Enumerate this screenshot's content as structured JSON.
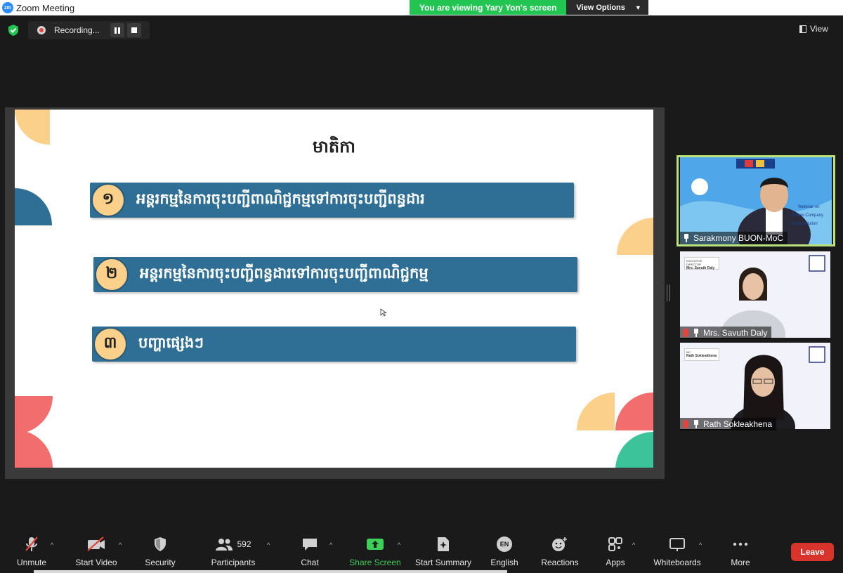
{
  "window": {
    "title": "Zoom Meeting",
    "logo_text": "zm"
  },
  "banner": {
    "viewing": "You are viewing Yary Yon's screen",
    "view_options": "View Options"
  },
  "recording": {
    "label": "Recording..."
  },
  "view_button": {
    "label": "View"
  },
  "slide": {
    "title": "មាតិកា",
    "items": [
      {
        "num": "១",
        "text": "អន្តរកម្មនៃការចុះបញ្ជីពាណិជ្ជកម្មទៅការចុះបញ្ជីពន្ធដារ"
      },
      {
        "num": "២",
        "text": "អន្តរកម្មនៃការចុះបញ្ជីពន្ធដារទៅការចុះបញ្ជីពាណិជ្ជកម្ម"
      },
      {
        "num": "៣",
        "text": "បញ្ហាផ្សេងៗ"
      }
    ]
  },
  "participants": [
    {
      "name": "Sarakmony BUON-MoC",
      "active": true,
      "muted": false,
      "slide_lines": [
        "Webinar on",
        "of New Company",
        "nd Dissolution"
      ]
    },
    {
      "name": "Mrs. Savuth Daly",
      "active": false,
      "muted": true,
      "tag_top": "EXECUTIVE DIRECTOR",
      "tag_name": "Mrs. Savuth Daly"
    },
    {
      "name": "Rath Sokleakhena",
      "active": false,
      "muted": true,
      "tag_top": "MC",
      "tag_name": "Rath Sokleakhena"
    }
  ],
  "toolbar": {
    "unmute": "Unmute",
    "start_video": "Start Video",
    "security": "Security",
    "participants": "Participants",
    "participants_count": "592",
    "chat": "Chat",
    "share_screen": "Share Screen",
    "start_summary": "Start Summary",
    "english": "English",
    "english_badge": "EN",
    "reactions": "Reactions",
    "apps": "Apps",
    "whiteboards": "Whiteboards",
    "more": "More",
    "leave": "Leave"
  },
  "colors": {
    "zoom_green": "#23c552",
    "slide_bar": "#2f6f95",
    "number_circle": "#fbd08a",
    "leave_red": "#d9342b",
    "active_border": "#b9e27a"
  }
}
